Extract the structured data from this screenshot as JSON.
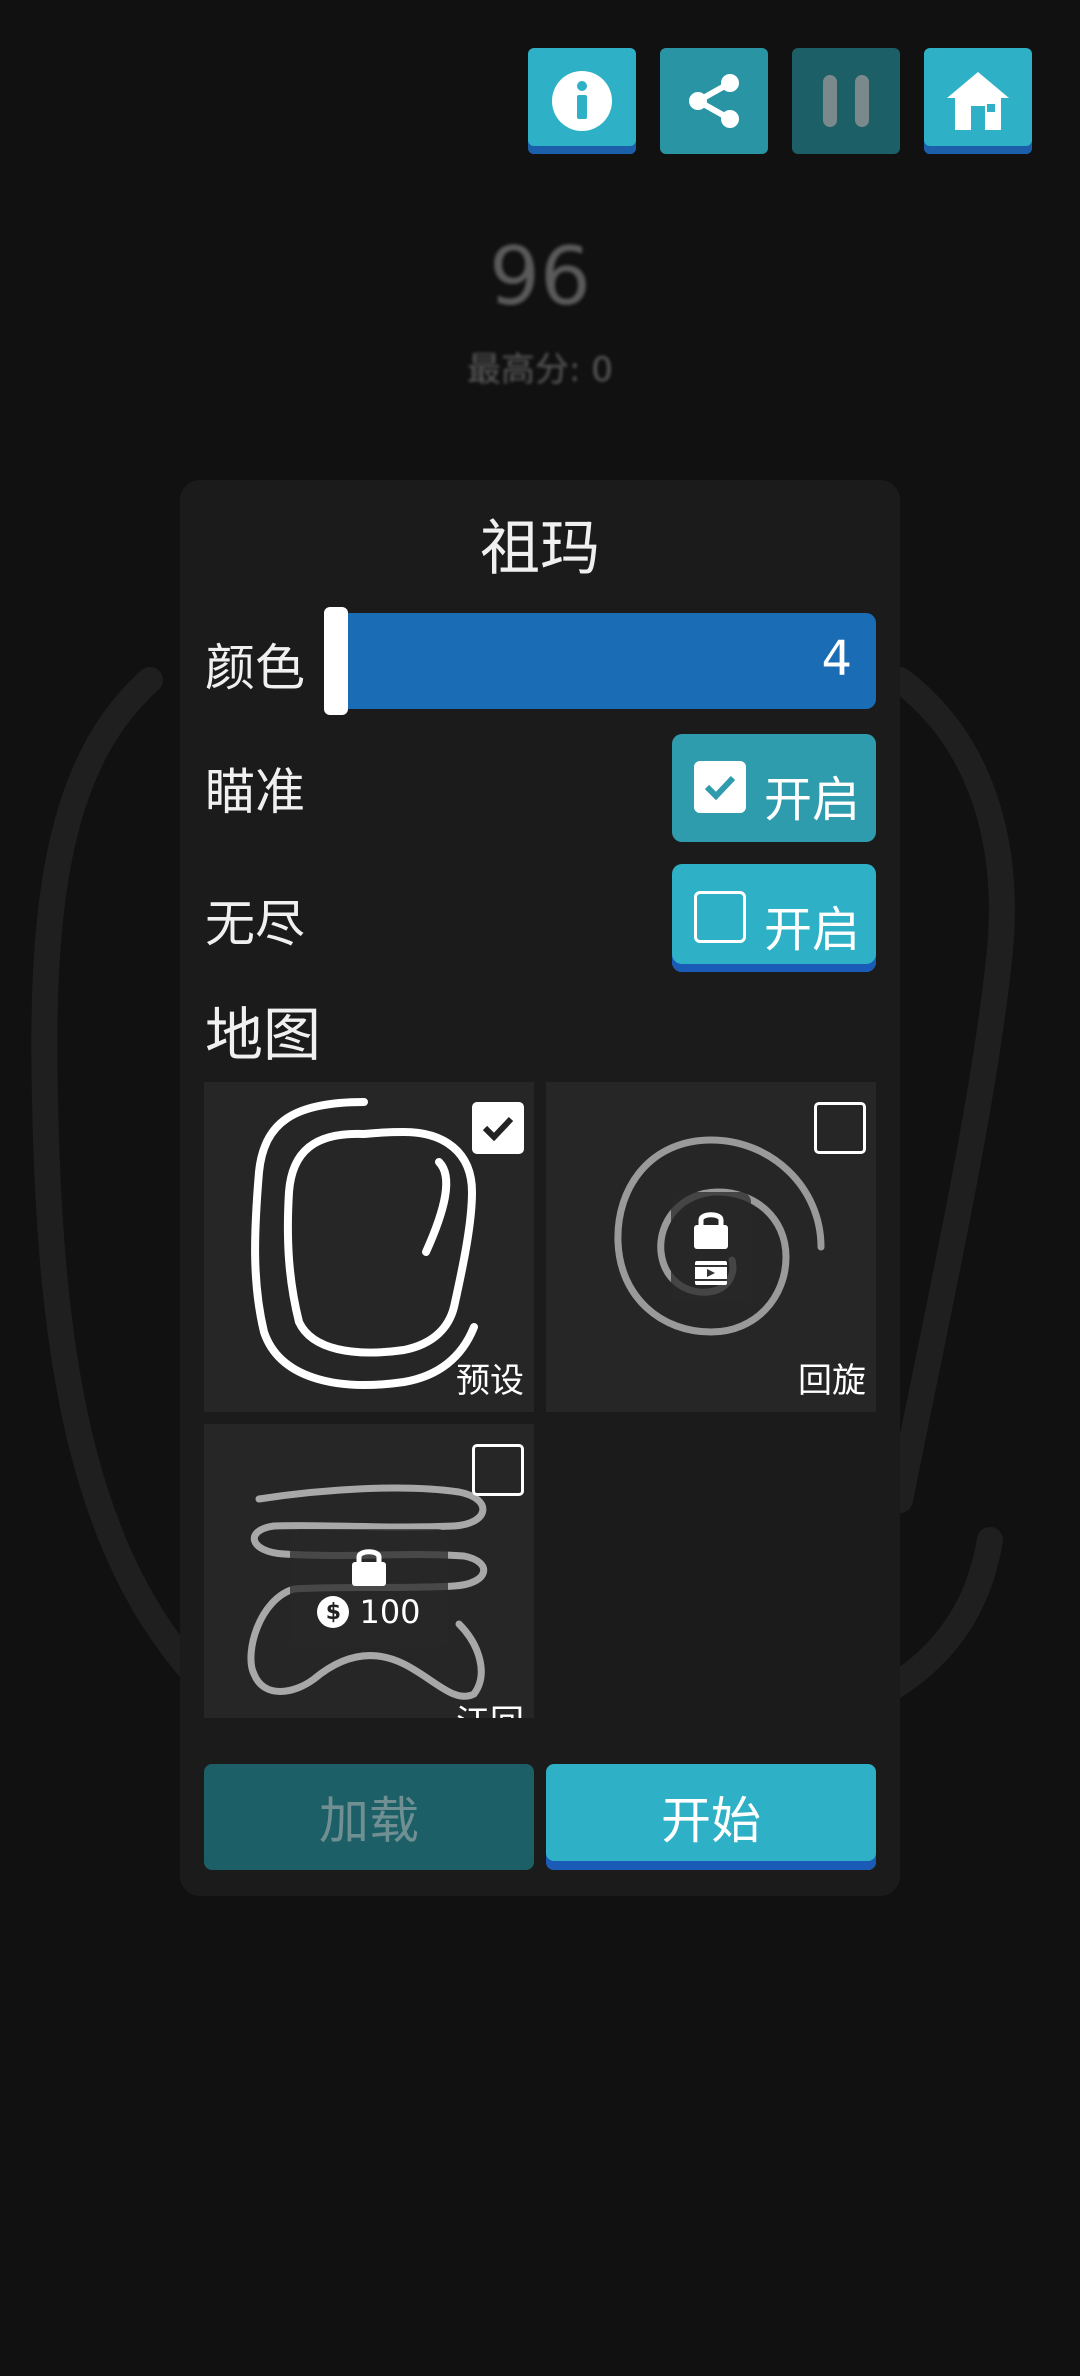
{
  "colors": {
    "accent": "#2eb1c6",
    "accent_dark": "#1d5f66",
    "slider": "#1a6cb5",
    "panel": "#1b1b1b",
    "background": "#111111"
  },
  "header": {
    "buttons": [
      {
        "name": "info-button",
        "icon": "info-icon"
      },
      {
        "name": "share-button",
        "icon": "share-icon"
      },
      {
        "name": "pause-button",
        "icon": "pause-icon"
      },
      {
        "name": "home-button",
        "icon": "home-icon"
      }
    ]
  },
  "score": {
    "value": "96",
    "best_label": "最高分: 0"
  },
  "dialog": {
    "title": "祖玛",
    "color_label": "颜色",
    "color_value": "4",
    "aim_label": "瞄准",
    "aim_toggle": {
      "label": "开启",
      "checked": true
    },
    "endless_label": "无尽",
    "endless_toggle": {
      "label": "开启",
      "checked": false
    },
    "map_section_title": "地图",
    "maps": [
      {
        "label": "预设",
        "selected": true,
        "locked": false
      },
      {
        "label": "回旋",
        "selected": false,
        "locked": true,
        "unlock": "video-ad-icon"
      },
      {
        "label": "江回",
        "selected": false,
        "locked": true,
        "price": "100"
      }
    ],
    "load_button": "加载",
    "start_button": "开始"
  }
}
